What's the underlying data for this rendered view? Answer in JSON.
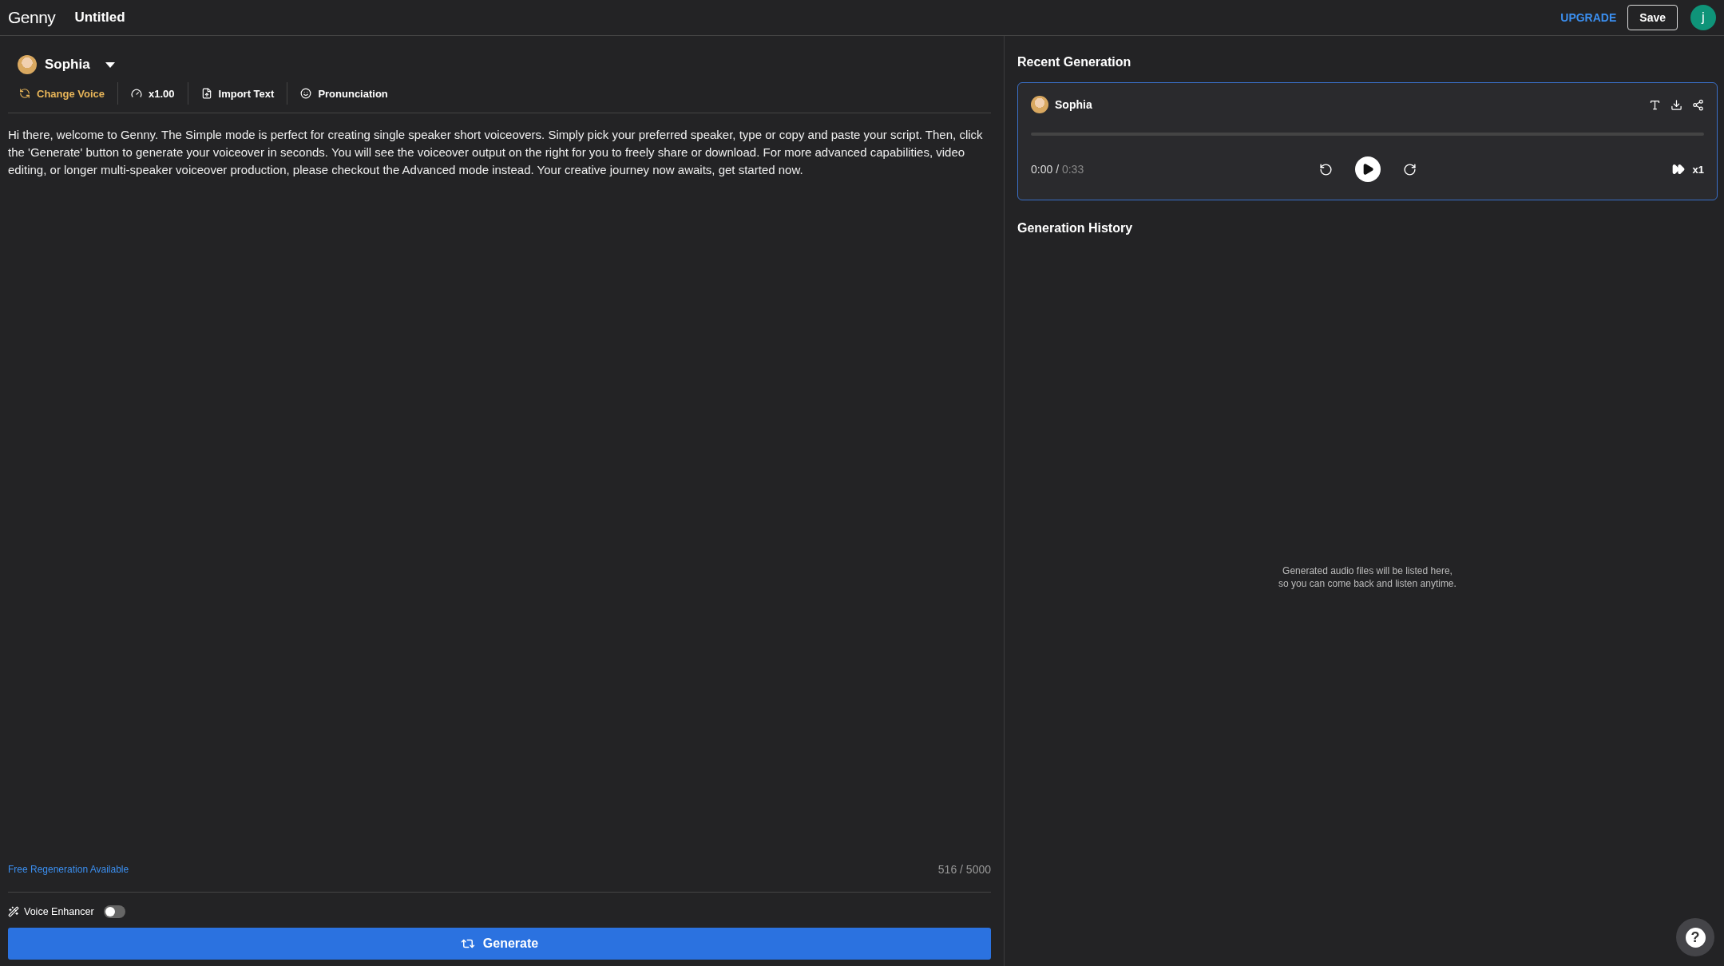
{
  "header": {
    "logo": "Genny",
    "title": "Untitled",
    "upgrade": "UPGRADE",
    "save": "Save",
    "avatar_initial": "j"
  },
  "editor": {
    "voice": "Sophia",
    "toolbar": [
      {
        "kind": "voice",
        "label": "Change Voice"
      },
      {
        "kind": "speed",
        "label": "x1.00"
      },
      {
        "kind": "import",
        "label": "Import Text"
      },
      {
        "kind": "pronunciation",
        "label": "Pronunciation"
      }
    ],
    "script": "Hi there, welcome to Genny. The Simple mode is perfect for creating single speaker short voiceovers. Simply pick your preferred speaker, type or copy and paste your script. Then, click the 'Generate' button to generate your voiceover in seconds. You will see the voiceover output on the right for you to freely share or download. For more advanced capabilities, video editing, or longer multi-speaker voiceover production, please checkout the Advanced mode instead. Your creative journey now awaits, get started now.",
    "free_regeneration": "Free Regeneration Available",
    "char_count": "516 / 5000",
    "voice_enhancer": {
      "label": "Voice Enhancer",
      "on": false
    },
    "generate": "Generate"
  },
  "recent": {
    "title": "Recent Generation",
    "speaker": "Sophia",
    "progress": {
      "level": 0
    },
    "current": "0:00",
    "separator": " / ",
    "duration": "0:33",
    "speed": "x1"
  },
  "history": {
    "title": "Generation History",
    "empty": [
      "Generated audio files will be listed here,",
      "so you can come back and listen anytime."
    ]
  },
  "help": "?"
}
